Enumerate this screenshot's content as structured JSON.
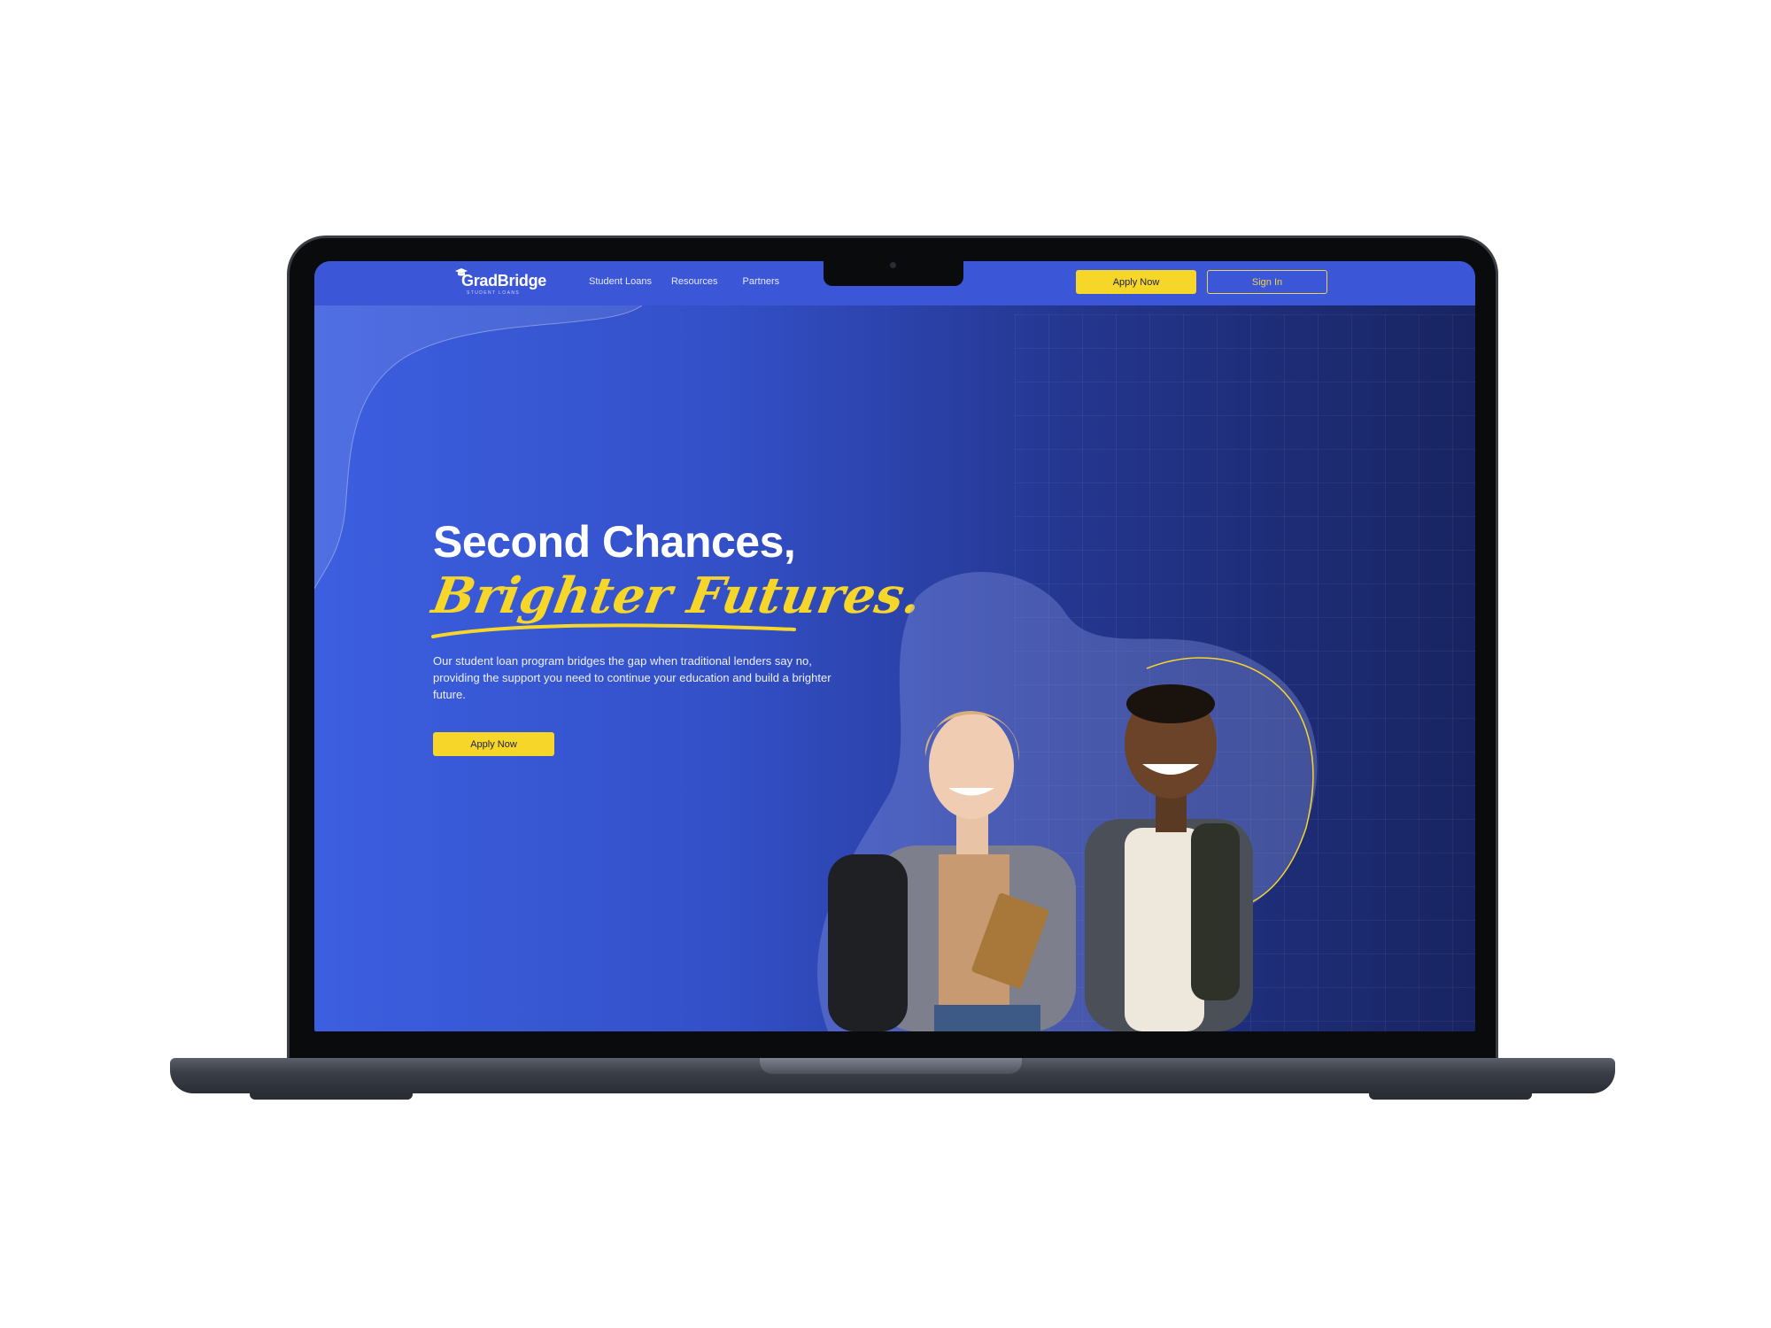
{
  "brand": {
    "name": "GradBridge",
    "tagline": "STUDENT LOANS"
  },
  "nav": {
    "links": [
      "Student Loans",
      "Resources",
      "Partners"
    ],
    "apply_label": "Apply Now",
    "signin_label": "Sign In"
  },
  "hero": {
    "headline": "Second Chances,",
    "script": "Brighter Futures.",
    "lead": "Our student loan program bridges the gap when traditional lenders say no, providing the support you need to continue your education and build a brighter future.",
    "cta_label": "Apply Now"
  },
  "colors": {
    "accent": "#f7d62a",
    "nav_bg": "#3c56d8",
    "hero_left": "#3c5fe0",
    "hero_right": "#182461"
  },
  "icons": {
    "logo": "graduation-cap-icon"
  }
}
